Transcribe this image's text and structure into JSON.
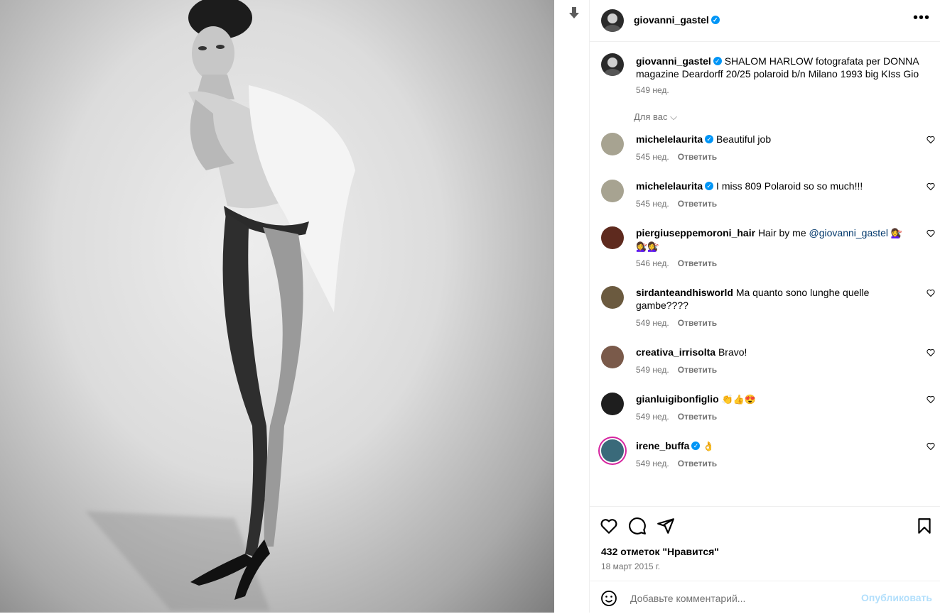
{
  "post": {
    "author": "giovanni_gastel",
    "author_verified": true,
    "more_icon": "more-horizontal-icon",
    "caption_text": "SHALOM HARLOW fotografata per DONNA magazine Deardorff 20/25 polaroid b/n Milano 1993 big KIss Gio",
    "caption_time": "549 нед.",
    "for_you_label": "Для вас"
  },
  "comments": [
    {
      "user": "michelelaurita",
      "verified": true,
      "text": "Beautiful job",
      "time": "545 нед.",
      "reply": "Ответить"
    },
    {
      "user": "michelelaurita",
      "verified": true,
      "text": "I miss 809 Polaroid so so much!!!",
      "time": "545 нед.",
      "reply": "Ответить"
    },
    {
      "user": "piergiuseppemoroni_hair",
      "verified": false,
      "text": "Hair by me",
      "mention": "@giovanni_gastel",
      "emoji": "💇‍♀️💇‍♀️💇‍♀️",
      "time": "546 нед.",
      "reply": "Ответить"
    },
    {
      "user": "sirdanteandhisworld",
      "verified": false,
      "text": "Ma quanto sono lunghe quelle gambe????",
      "time": "549 нед.",
      "reply": "Ответить"
    },
    {
      "user": "creativa_irrisolta",
      "verified": false,
      "text": "Bravo!",
      "time": "549 нед.",
      "reply": "Ответить"
    },
    {
      "user": "gianluigibonfiglio",
      "verified": false,
      "text": "",
      "emoji": "👏👍😍",
      "time": "549 нед.",
      "reply": "Ответить"
    },
    {
      "user": "irene_buffa",
      "verified": true,
      "text": "",
      "emoji": "👌",
      "time": "549 нед.",
      "reply": "Ответить"
    }
  ],
  "actions": {
    "likes": "432 отметок \"Нравится\"",
    "date": "18 март 2015 г.",
    "icons": [
      "heart-icon",
      "comment-icon",
      "share-icon",
      "bookmark-icon"
    ]
  },
  "composer": {
    "placeholder": "Добавьте комментарий...",
    "post_label": "Опубликовать",
    "emoji_icon": "emoji-icon"
  },
  "colors": {
    "accent": "#0095f6",
    "post_disabled": "#b2dffc",
    "meta": "#737373",
    "mention": "#00376b"
  }
}
